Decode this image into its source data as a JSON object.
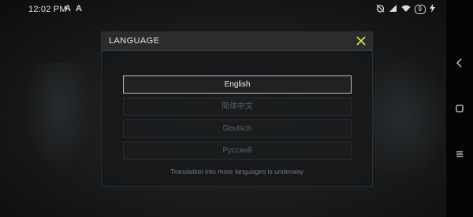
{
  "status_bar": {
    "time": "12:02 PM",
    "notif_1": "A",
    "notif_2": "A",
    "battery": "9"
  },
  "dialog": {
    "title": "LANGUAGE",
    "options": [
      {
        "label": "English",
        "selected": true
      },
      {
        "label": "简体中文",
        "selected": false
      },
      {
        "label": "Deutsch",
        "selected": false
      },
      {
        "label": "Русский",
        "selected": false
      }
    ],
    "note": "Translation into more languages is underway"
  },
  "icons": {
    "close": "close-icon",
    "back": "back-icon",
    "home": "home-icon",
    "recents": "recents-icon"
  },
  "colors": {
    "close_icon": "#d6e55a",
    "selected_border": "#bcbcbc",
    "header_bg": "#2a2c2e"
  }
}
